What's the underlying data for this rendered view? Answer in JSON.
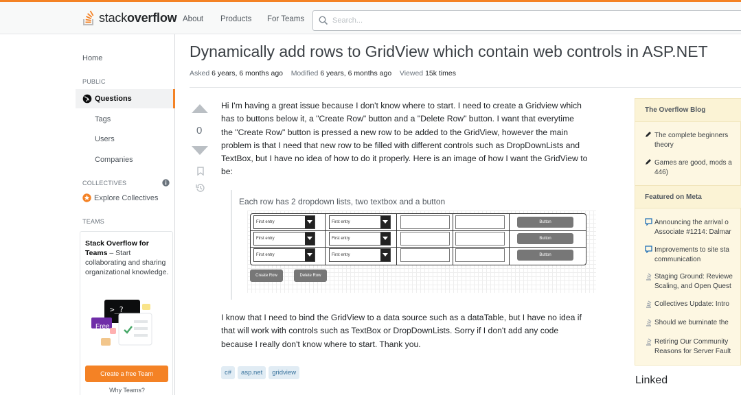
{
  "brand": {
    "logo_light": "stack",
    "logo_bold": "overflow",
    "accent": "#f48225"
  },
  "header": {
    "nav": [
      "About",
      "Products",
      "For Teams"
    ],
    "search_placeholder": "Search..."
  },
  "sidebar": {
    "home": "Home",
    "public_heading": "PUBLIC",
    "questions": "Questions",
    "items": [
      "Tags",
      "Users",
      "Companies"
    ],
    "collectives_heading": "COLLECTIVES",
    "explore_collectives": "Explore Collectives",
    "teams_heading": "TEAMS",
    "teams_title": "Stack Overflow for Teams",
    "teams_desc": " – Start collaborating and sharing organizational knowledge.",
    "teams_free_badge": "Free",
    "create_team": "Create a free Team",
    "why_teams": "Why Teams?"
  },
  "question": {
    "title": "Dynamically add rows to GridView which contain web controls in ASP.NET",
    "asked_label": "Asked",
    "asked_value": "6 years, 6 months ago",
    "modified_label": "Modified",
    "modified_value": "6 years, 6 months ago",
    "viewed_label": "Viewed",
    "viewed_value": "15k times",
    "votes": "0",
    "body_lines_1": [
      "Hi I'm having a great issue because I don't know where to start. I need to create a Gridview which",
      "has to buttons below it, a \"Create Row\" button and a \"Delete Row\" button. I want that everytime",
      "the \"Create Row\" button is pressed a new row to be added to the GridView, however the main",
      "problem is that I need that new row to be filled with different controls such as DropDownLists and",
      "TextBox, but I have no idea of how to do it properly. Here is an image of how I want the GridView to",
      "be:"
    ],
    "body_lines_2": [
      "I know that I need to bind the GridView to a data source such as a dataTable, but I have no idea if",
      "that will work with controls such as TextBox or DropDownLists. Sorry if I don't add any code",
      "because I really don't know where to start. Thank you."
    ],
    "tags": [
      "c#",
      "asp.net",
      "gridview"
    ]
  },
  "figure": {
    "caption": "Each row has 2 dropdown lists, two textbox and a button",
    "dropdown_value": "First entry",
    "row_button": "Button",
    "create_row": "Create Row",
    "delete_row": "Delete Row"
  },
  "right": {
    "blog_heading": "The Overflow Blog",
    "blog_items": [
      [
        "The complete beginners",
        "theory"
      ],
      [
        "Games are good, mods a",
        "446)"
      ]
    ],
    "meta_heading": "Featured on Meta",
    "meta_items": [
      [
        "Announcing the arrival o",
        "Associate #1214: Dalmar"
      ],
      [
        "Improvements to site sta",
        "communication"
      ],
      [
        "Staging Ground: Reviewe",
        "Scaling, and Open Quest"
      ],
      [
        "Collectives Update: Intro"
      ],
      [
        "Should we burninate the"
      ],
      [
        "Retiring Our Community",
        "Reasons for Server Fault"
      ]
    ],
    "linked": "Linked"
  }
}
